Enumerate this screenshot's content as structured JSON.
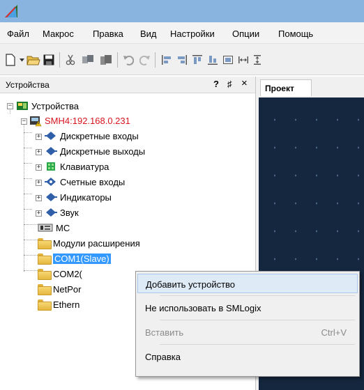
{
  "menu": [
    "Файл",
    "Макрос",
    "Правка",
    "Вид",
    "Настройки",
    "Опции",
    "Помощь"
  ],
  "panel": {
    "title": "Устройства",
    "help_glyph": "?",
    "pin_glyph": "♯",
    "close_glyph": "×"
  },
  "tree": {
    "root": "Устройства",
    "device": "SMH4:192.168.0.231",
    "children": [
      "Дискретные входы",
      "Дискретные выходы",
      "Клавиатура",
      "Счетные входы",
      "Индикаторы",
      "Звук",
      "MC",
      "Модули расширения",
      "COM1(Slave)",
      "COM2(",
      "NetPor",
      "Ethern"
    ]
  },
  "document": {
    "tab_label": "Проект"
  },
  "context_menu": {
    "add_device": "Добавить устройство",
    "do_not_use": "Не использовать в SMLogix",
    "paste": "Вставить",
    "paste_shortcut": "Ctrl+V",
    "help": "Справка"
  },
  "colors": {
    "device_label": "#d8141e",
    "selection": "#3399ff",
    "canvas": "#14273e",
    "titlebar": "#8ab4e0"
  }
}
